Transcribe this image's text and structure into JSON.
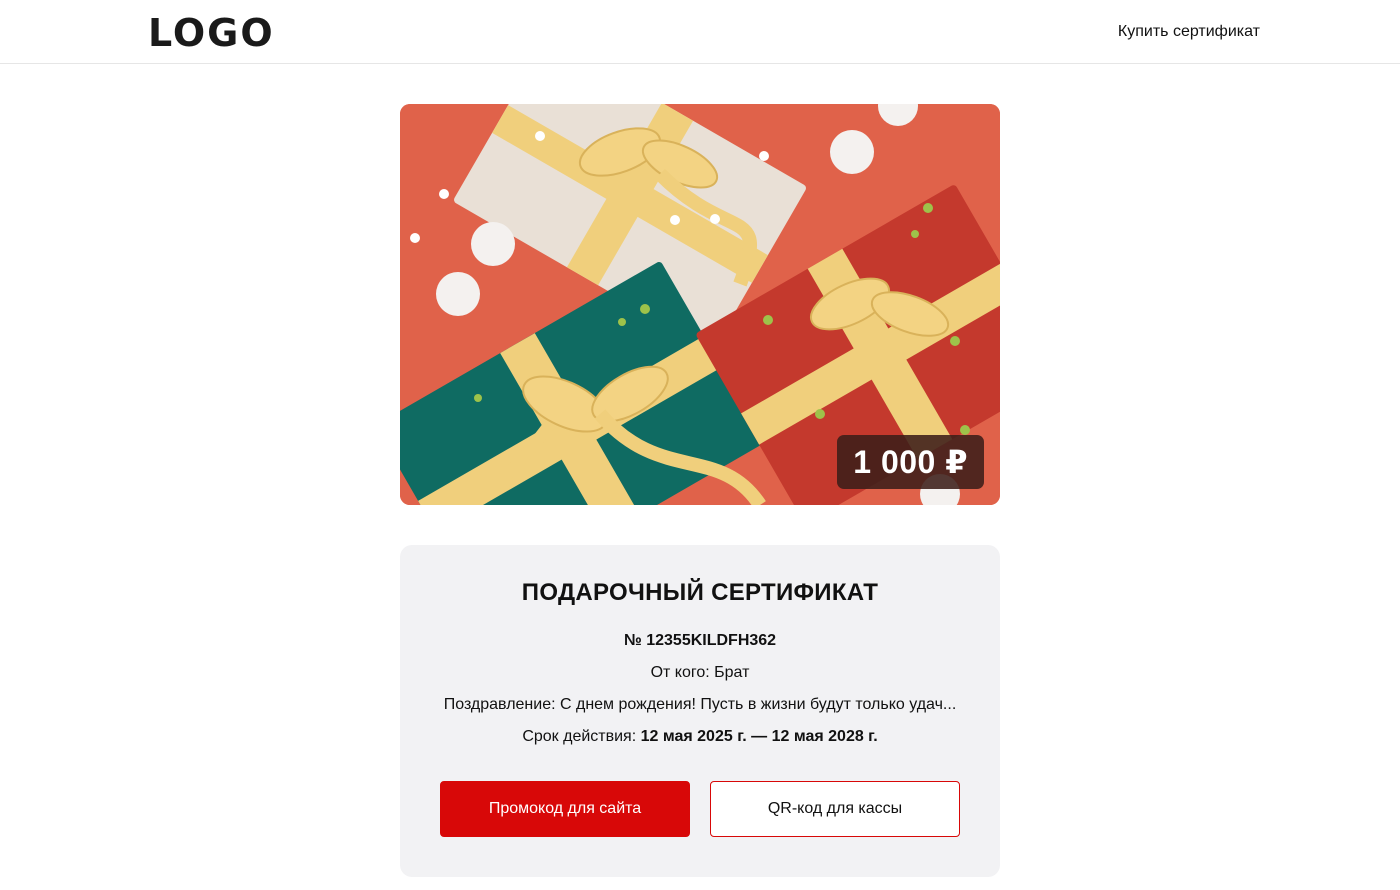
{
  "header": {
    "logo": "LOGO",
    "buy_link": "Купить сертификат"
  },
  "hero": {
    "image": "gift-boxes-photo",
    "price": "1 000 ₽"
  },
  "certificate": {
    "title": "ПОДАРОЧНЫЙ СЕРТИФИКАТ",
    "number": "№ 12355KILDFH362",
    "from": "От кого: Брат",
    "greeting": "Поздравление: С днем рождения! Пусть в жизни будут только удач...",
    "validity_label": "Срок действия: ",
    "validity_value": "12 мая 2025 г. — 12 мая 2028 г."
  },
  "buttons": {
    "promo": "Промокод для сайта",
    "qr": "QR-код для кассы"
  },
  "colors": {
    "accent": "#d80808",
    "card_bg": "#f2f2f4",
    "hero_bg": "#e0624a"
  }
}
